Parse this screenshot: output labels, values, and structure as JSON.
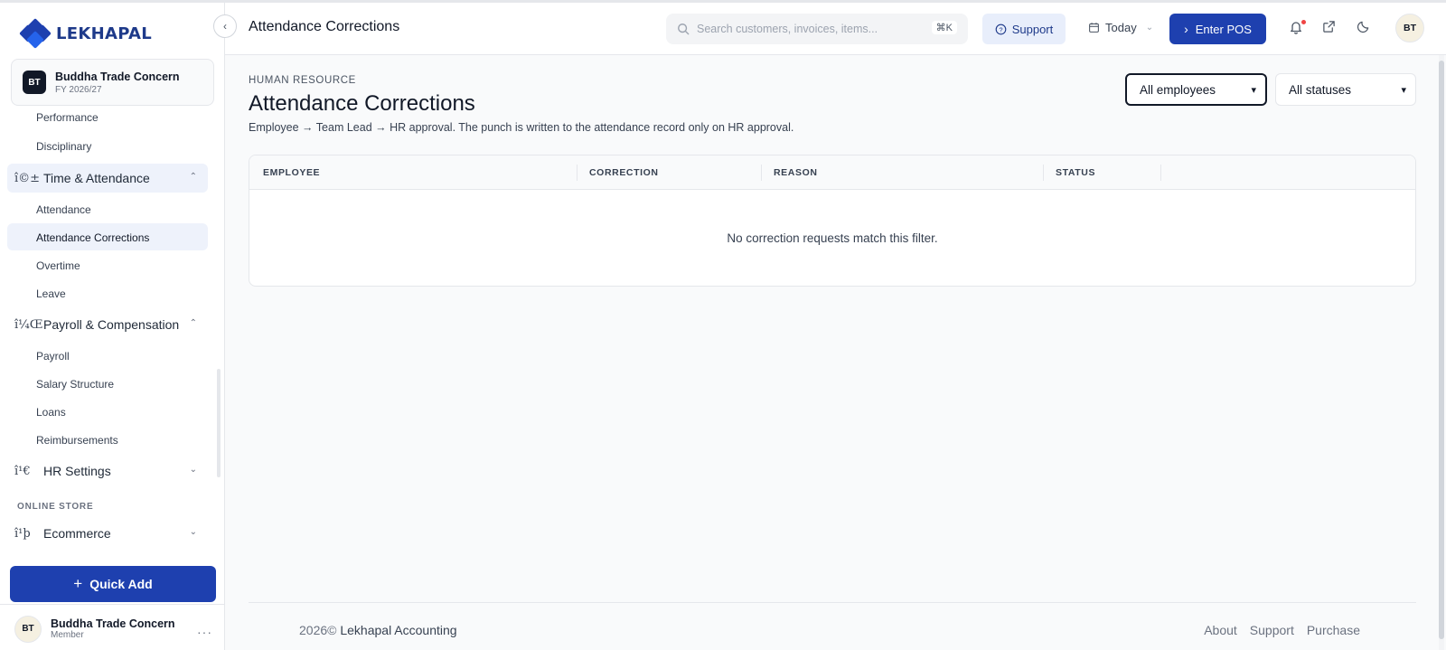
{
  "brand": {
    "name": "LEKHAPAL"
  },
  "org": {
    "initials": "BT",
    "name": "Buddha Trade Concern",
    "fiscal_year": "FY 2026/27"
  },
  "sidebar": {
    "items": [
      {
        "label": "Performance"
      },
      {
        "label": "Disciplinary"
      }
    ],
    "time_attendance": {
      "label": "Time & Attendance",
      "icon_glyph": "î©±",
      "items": [
        {
          "label": "Attendance"
        },
        {
          "label": "Attendance Corrections"
        },
        {
          "label": "Overtime"
        },
        {
          "label": "Leave"
        }
      ]
    },
    "payroll": {
      "label": "Payroll & Compensation",
      "icon_glyph": "î¼Œ",
      "items": [
        {
          "label": "Payroll"
        },
        {
          "label": "Salary Structure"
        },
        {
          "label": "Loans"
        },
        {
          "label": "Reimbursements"
        }
      ]
    },
    "hr_settings": {
      "label": "HR Settings",
      "icon_glyph": "î¹€"
    },
    "section_online_store": "ONLINE STORE",
    "ecommerce": {
      "label": "Ecommerce",
      "icon_glyph": "î¹þ"
    },
    "quick_add_label": "Quick Add"
  },
  "user": {
    "initials": "BT",
    "name": "Buddha Trade Concern",
    "role": "Member"
  },
  "topbar": {
    "title": "Attendance Corrections",
    "search_placeholder": "Search customers, invoices, items...",
    "search_shortcut": "⌘K",
    "support_label": "Support",
    "date_label": "Today",
    "pos_label": "Enter POS",
    "avatar_initials": "BT"
  },
  "page": {
    "eyebrow": "HUMAN RESOURCE",
    "title": "Attendance Corrections",
    "description": "Employee → Team Lead → HR approval. The punch is written to the attendance record only on HR approval.",
    "filters": {
      "employee": "All employees",
      "status": "All statuses"
    },
    "table": {
      "columns": [
        "EMPLOYEE",
        "CORRECTION",
        "REASON",
        "STATUS"
      ],
      "empty_message": "No correction requests match this filter."
    }
  },
  "footer": {
    "year": "2026©",
    "company": "Lekhapal Accounting",
    "links": [
      "About",
      "Support",
      "Purchase"
    ]
  }
}
